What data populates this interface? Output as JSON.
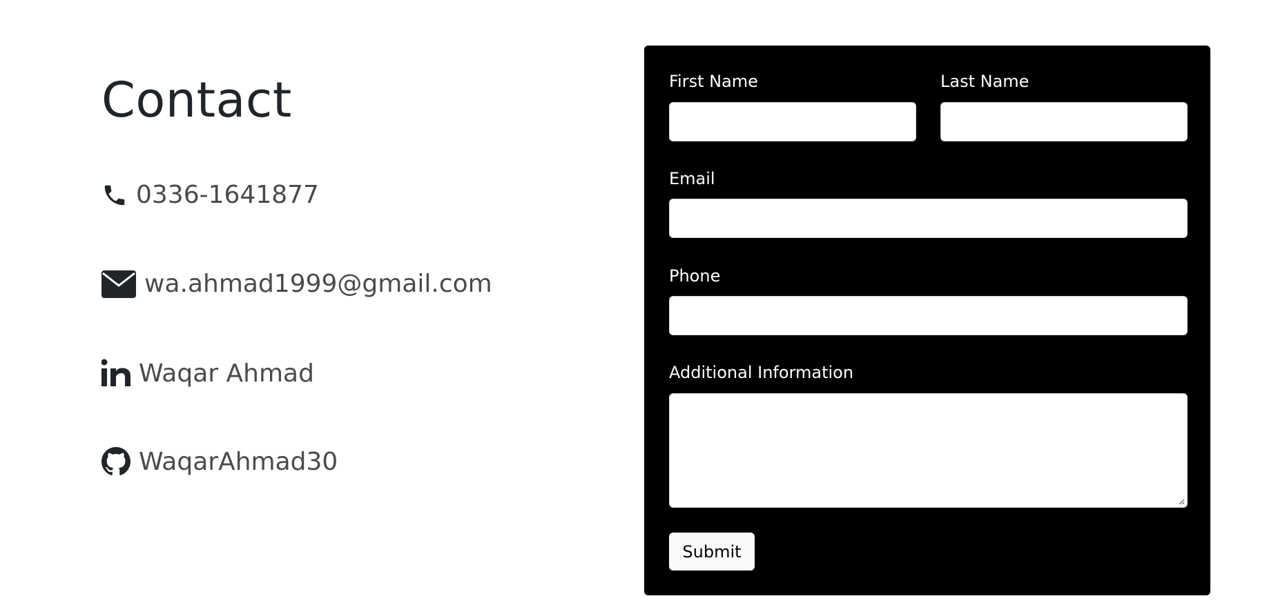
{
  "contact": {
    "title": "Contact",
    "items": [
      {
        "icon": "phone-icon",
        "text": "0336-1641877"
      },
      {
        "icon": "envelope-icon",
        "text": "wa.ahmad1999@gmail.com"
      },
      {
        "icon": "linkedin-icon",
        "text": "Waqar Ahmad"
      },
      {
        "icon": "github-icon",
        "text": "WaqarAhmad30"
      }
    ]
  },
  "form": {
    "first_name_label": "First Name",
    "first_name_value": "",
    "last_name_label": "Last Name",
    "last_name_value": "",
    "email_label": "Email",
    "email_value": "",
    "phone_label": "Phone",
    "phone_value": "",
    "additional_label": "Additional Information",
    "additional_value": "",
    "submit_label": "Submit"
  },
  "colors": {
    "form_background": "#000000",
    "text_dark": "#212529",
    "text_muted": "#4a4a4a",
    "button_background": "#f8f9fa"
  }
}
